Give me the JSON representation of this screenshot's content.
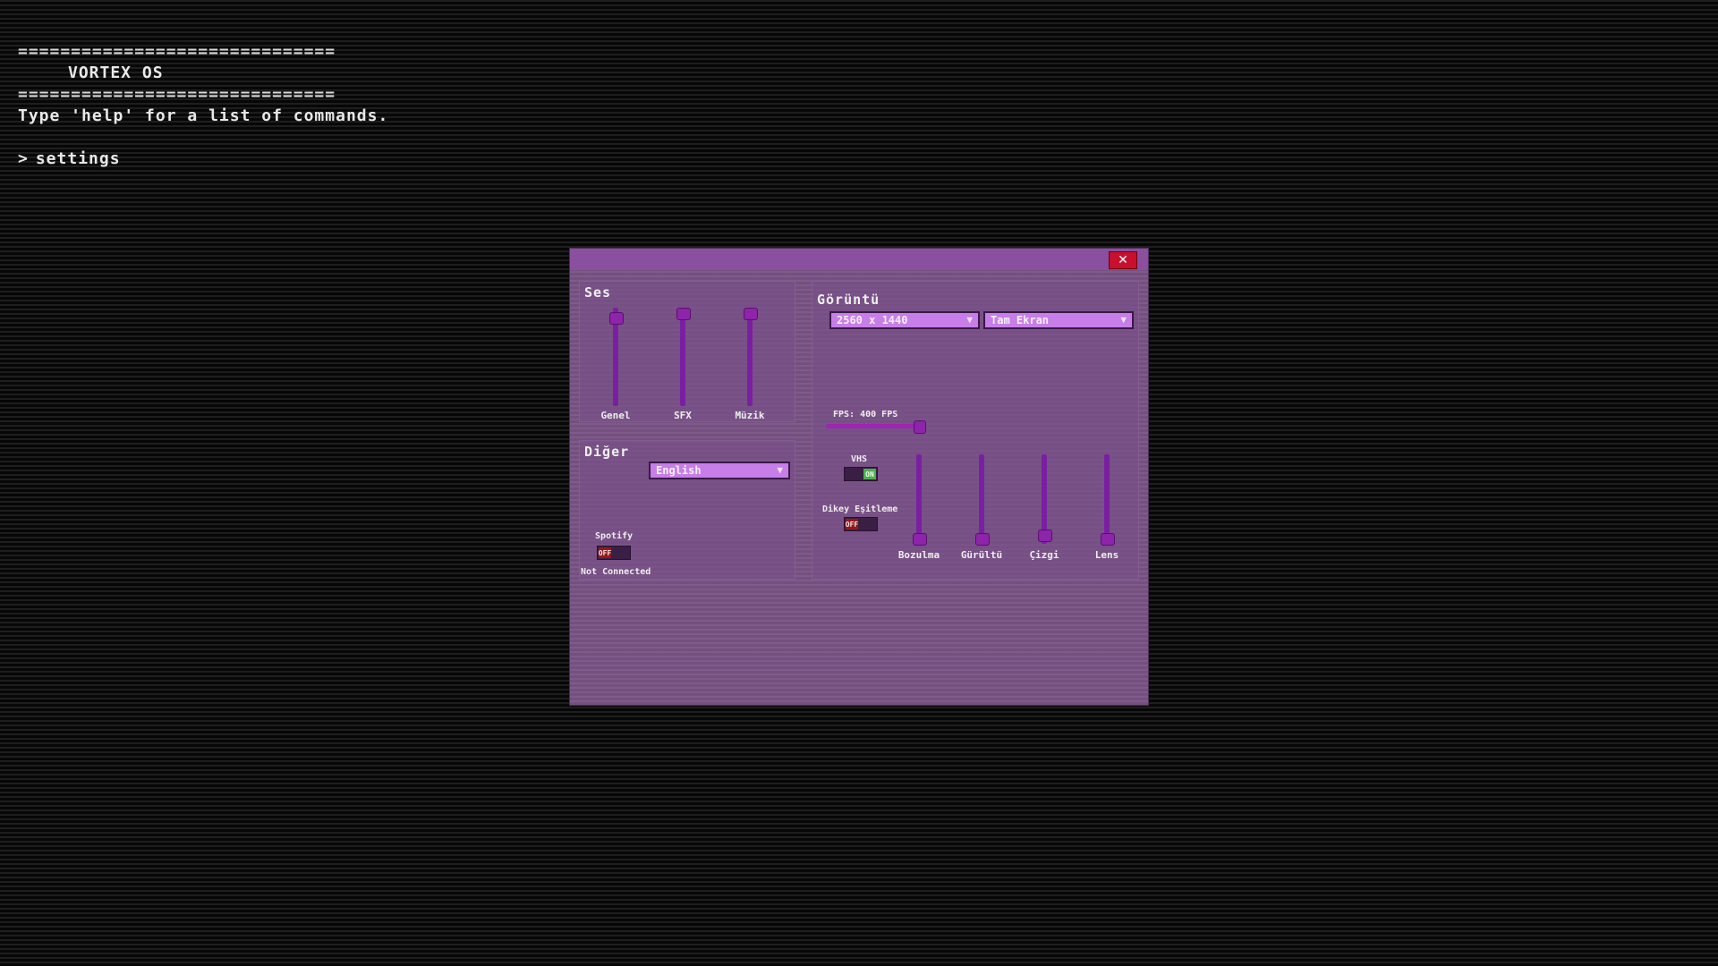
{
  "terminal": {
    "separator": "==============================",
    "os_title": "VORTEX OS",
    "help_hint": "Type 'help' for a list of commands.",
    "prompt_symbol": ">",
    "command": "settings"
  },
  "window": {
    "close_label": "✕",
    "audio": {
      "title": "Ses",
      "sliders": [
        {
          "label": "Genel",
          "level": 0.95
        },
        {
          "label": "SFX",
          "level": 1.0
        },
        {
          "label": "Müzik",
          "level": 1.0
        }
      ]
    },
    "other": {
      "title": "Diğer",
      "language": "English",
      "spotify_label": "Spotify",
      "spotify_toggle": "OFF",
      "spotify_status": "Not Connected"
    },
    "display": {
      "title": "Görüntü",
      "resolution": "2560 x 1440",
      "window_mode": "Tam Ekran",
      "fps_label": "FPS: 400 FPS",
      "fps_level": 1.0,
      "vhs_label": "VHS",
      "vhs_toggle": "ON",
      "vsync_label": "Dikey Eşitleme",
      "vsync_toggle": "OFF",
      "effects": [
        {
          "label": "Bozulma",
          "level": 0.0
        },
        {
          "label": "Gürültü",
          "level": 0.0
        },
        {
          "label": "Çizgi",
          "level": 0.05
        },
        {
          "label": "Lens",
          "level": 0.0
        }
      ]
    }
  },
  "colors": {
    "accent": "#9c27b0",
    "window_bg": "#7a5486",
    "close": "#c8102e",
    "toggle_on": "#4caf50",
    "toggle_off": "#8e1b1b"
  }
}
